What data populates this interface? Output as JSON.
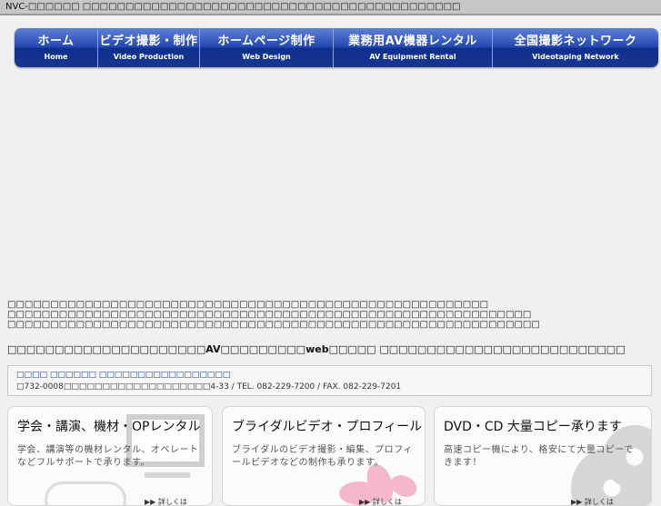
{
  "topbar": {
    "text": "NVC-□□□□□□ □□□□□□□□□□□□□□□□□□□□□□□□□□□□□□□□□□□□□□□□□□□□"
  },
  "nav": [
    {
      "jp": "ホーム",
      "en": "Home"
    },
    {
      "jp": "ビデオ撮影・制作",
      "en": "Video Production"
    },
    {
      "jp": "ホームページ制作",
      "en": "Web Design"
    },
    {
      "jp": "業務用AV機器レンタル",
      "en": "AV Equipment Rental"
    },
    {
      "jp": "全国撮影ネットワーク",
      "en": "Videotaping Network"
    }
  ],
  "intro": [
    "□□□□□□□□□□□□□□□□□□□□□□□□□□□□□□□□□□□□□□□□□□□□□□□□□□□□□□□□",
    "□□□□□□□□□□□□□□□□□□□□□□□□□□□□□□□□□□□□□□□□□□□□□□□□□□□□□□□□□□□□□",
    "□□□□□□□□□□□□□□□□□□□□□□□□□□□□□□□□□□□□□□□□□□□□□□□□□□□□□□□□□□□□□□"
  ],
  "headline": "□□□□□□□□□□□□□□□□□□□□□AV□□□□□□□□□web□□□□□ □□□□□□□□□□□□□□□□□□□□□□□□□□",
  "info": {
    "company": "□□□□ □□□□□□ □□□□□□□□□□□□□□□□□",
    "address": "□732-0008□□□□□□□□□□□□□□□□□□□4-33 / TEL. 082-229-7200 / FAX. 082-229-7201"
  },
  "cards": [
    {
      "title": "学会・講演、機材・OPレンタル",
      "desc": "学会、講演等の機材レンタル、オペレートなどフルサポートで承ります。",
      "more": "▶▶ 詳しくは"
    },
    {
      "title": "ブライダルビデオ・プロフィール",
      "desc": "ブライダルのビデオ撮影・編集、プロフィールビデオなどの制作も承ります。",
      "more": "▶▶ 詳しくは"
    },
    {
      "title": "DVD・CD 大量コピー承ります",
      "desc": "高速コピー機により、格安にて大量コピーできます！",
      "more": "▶▶ 詳しくは"
    }
  ],
  "colors": {
    "nav_top": "#5e7fd6",
    "nav_bottom": "#0f2f8e",
    "link_blue": "#1a3f9a"
  }
}
